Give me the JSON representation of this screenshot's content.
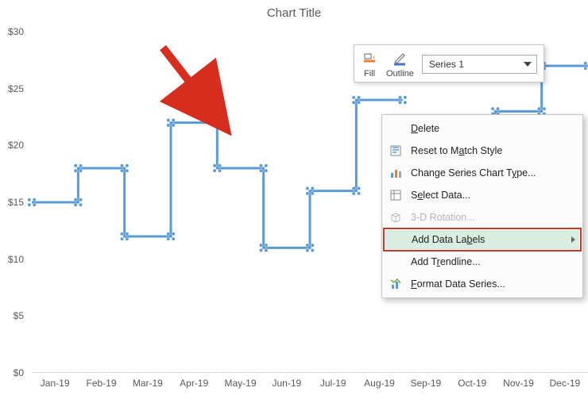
{
  "chart_data": {
    "type": "step-line",
    "title": "Chart Title",
    "xlabel": "",
    "ylabel": "",
    "y_ticks": [
      0,
      5,
      10,
      15,
      20,
      25,
      30
    ],
    "y_tick_labels": [
      "$0",
      "$5",
      "$10",
      "$15",
      "$20",
      "$25",
      "$30"
    ],
    "ylim": [
      0,
      30
    ],
    "categories": [
      "Jan-19",
      "Feb-19",
      "Mar-19",
      "Apr-19",
      "May-19",
      "Jun-19",
      "Jul-19",
      "Aug-19",
      "Sep-19",
      "Oct-19",
      "Nov-19",
      "Dec-19"
    ],
    "series": [
      {
        "name": "Series 1",
        "values": [
          15,
          18,
          12,
          22,
          18,
          11,
          16,
          24,
          null,
          21,
          23,
          27
        ]
      }
    ]
  },
  "toolbar": {
    "fill_label": "Fill",
    "outline_label": "Outline",
    "series_selector": "Series 1"
  },
  "context_menu": {
    "delete": "Delete",
    "reset": "Reset to Match Style",
    "change_type": "Change Series Chart Type...",
    "select_data": "Select Data...",
    "rotation_3d": "3-D Rotation...",
    "add_labels": "Add Data Labels",
    "add_trendline": "Add Trendline...",
    "format_series": "Format Data Series..."
  }
}
